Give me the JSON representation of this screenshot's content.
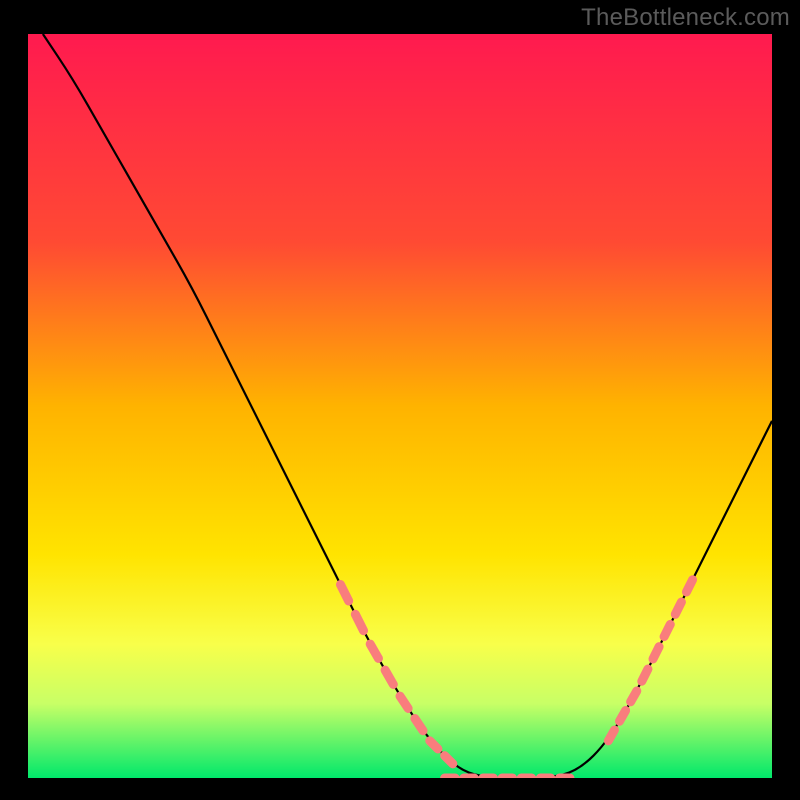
{
  "watermark": "TheBottleneck.com",
  "chart_data": {
    "type": "line",
    "title": "",
    "xlabel": "",
    "ylabel": "",
    "xlim": [
      0,
      100
    ],
    "ylim": [
      0,
      100
    ],
    "grid": false,
    "legend": false,
    "gradient_stops": [
      {
        "offset": 0,
        "color": "#ff1a4f"
      },
      {
        "offset": 28,
        "color": "#ff4a33"
      },
      {
        "offset": 50,
        "color": "#ffb300"
      },
      {
        "offset": 70,
        "color": "#ffe400"
      },
      {
        "offset": 82,
        "color": "#f8ff4a"
      },
      {
        "offset": 90,
        "color": "#c8ff66"
      },
      {
        "offset": 100,
        "color": "#00e86b"
      }
    ],
    "series": [
      {
        "name": "bottleneck-curve",
        "stroke": "#000000",
        "x": [
          2,
          6,
          10,
          14,
          18,
          22,
          26,
          30,
          34,
          38,
          42,
          46,
          50,
          54,
          58,
          62,
          66,
          70,
          74,
          78,
          82,
          86,
          90,
          94,
          98,
          100
        ],
        "y": [
          100,
          94,
          87,
          80,
          73,
          66,
          58,
          50,
          42,
          34,
          26,
          18,
          11,
          5,
          1,
          0,
          0,
          0,
          1,
          5,
          12,
          20,
          28,
          36,
          44,
          48
        ]
      }
    ],
    "dash_segments": {
      "name": "highlight-dashes",
      "color": "#f97d7d",
      "left_branch": {
        "x_range": [
          42,
          58
        ],
        "approx_y_range": [
          26,
          1
        ]
      },
      "right_branch": {
        "x_range": [
          78,
          90
        ],
        "approx_y_range": [
          5,
          28
        ]
      },
      "floor": {
        "x_range": [
          56,
          74
        ],
        "approx_y": 0
      }
    }
  }
}
